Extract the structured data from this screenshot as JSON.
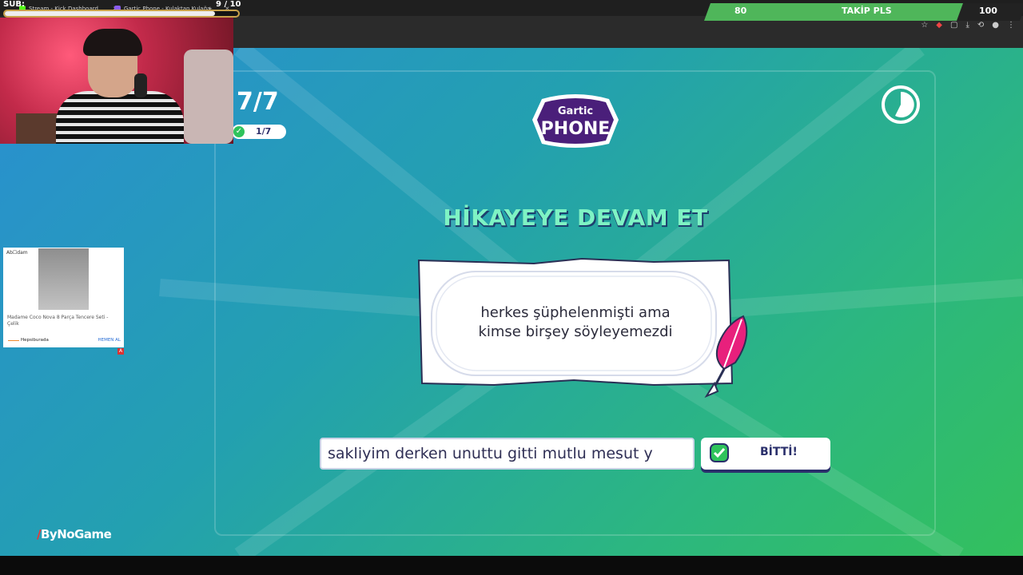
{
  "browser": {
    "tabs": [
      {
        "label": "Stream - Kick Dashboard"
      },
      {
        "label": "Gartic Phone - Kulaktan Kulağa"
      }
    ],
    "new_tab": "+"
  },
  "overlay": {
    "sub_label": "SUB:",
    "sub_count": "9 / 10",
    "sub_progress": 0.9,
    "goal_left": "80",
    "goal_title": "TAKİP PLS",
    "goal_right": "100",
    "goal_progress": 0.8,
    "sponsor": "ByNoGame"
  },
  "game": {
    "round_big": "7/7",
    "round_small": "1/7",
    "logo_top": "Gartic",
    "logo_bottom": "PHONE",
    "heading": "HİKAYEYE DEVAM ET",
    "prompt_line1": "herkes şüphelenmişti ama",
    "prompt_line2": "kimse birşey söyleyemezdi",
    "answer_value": "sakliyim derken unuttu gitti mutlu mesut y",
    "done_label": "BİTTİ!"
  },
  "ad": {
    "brand": "Ab☐dam",
    "title": "Madame Coco Nova 8 Parça Tencere Seti - Çelik",
    "shop": "Hepsiburada",
    "cta": "HEMEN AL",
    "badge": "A"
  },
  "colors": {
    "accent_green": "#2fc35c",
    "heading_green": "#7ef3c4",
    "navy": "#2a2f6b",
    "gradient_start": "#2a8fd1",
    "gradient_end": "#33c05d"
  }
}
